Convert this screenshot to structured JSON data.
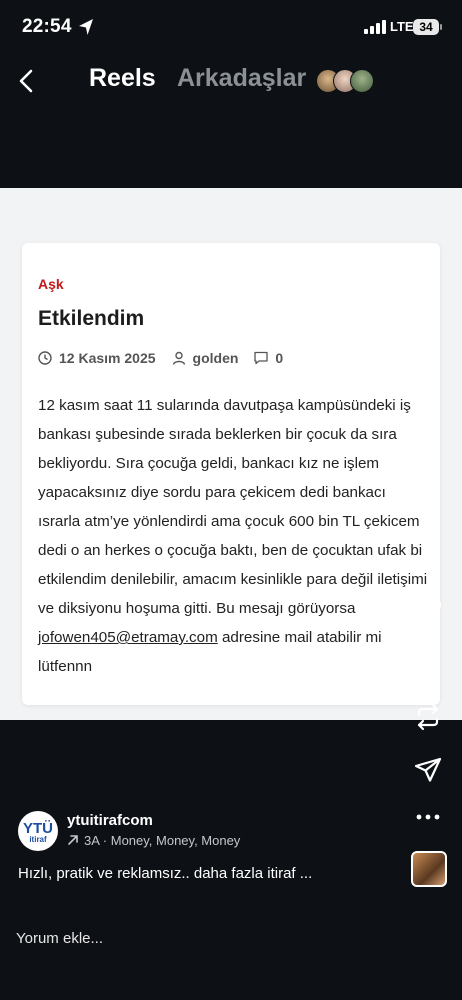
{
  "status": {
    "time": "22:54",
    "network": "LTE",
    "battery": "34"
  },
  "header": {
    "tab_reels": "Reels",
    "tab_friends": "Arkadaşlar"
  },
  "post": {
    "category": "Aşk",
    "title": "Etkilendim",
    "date": "12 Kasım 2025",
    "author": "golden",
    "comments": "0",
    "body_1": "12 kasım saat 11 sularında davutpaşa kampüsündeki iş bankası şubesinde sırada beklerken bir çocuk da sıra bekliyordu. Sıra çocuğa geldi, bankacı kız ne işlem yapacaksınız diye sordu para çekicem dedi bankacı ısrarla atm’ye yönlendirdi ama çocuk 600 bin TL çekicem dedi o an herkes o çocuğa baktı, ben de çocuktan ufak bi etkilendim denilebilir, amacım kesinlikle para değil iletişimi ve diksiyonu hoşuma gitti. Bu mesajı görüyorsa ",
    "email": "jofowen405@etramay.com",
    "body_2": " adresine mail atabilir mi lütfennn"
  },
  "account": {
    "logo_text": "YTÜ",
    "logo_sub": "itiraf",
    "name": "ytuitirafcom",
    "music": "3A · Money, Money, Money",
    "caption": "Hızlı, pratik ve reklamsız.. daha fazla itiraf ..."
  },
  "comment_bar": {
    "placeholder": "Yorum ekle..."
  },
  "icons": {
    "back": "chevron-left-icon",
    "like": "heart-icon",
    "comment": "comment-bubble-icon",
    "repost": "repost-icon",
    "share": "paper-plane-icon",
    "more": "more-dots-icon"
  },
  "colors": {
    "background": "#0d1115",
    "category": "#c01a1a",
    "card": "#ffffff"
  }
}
